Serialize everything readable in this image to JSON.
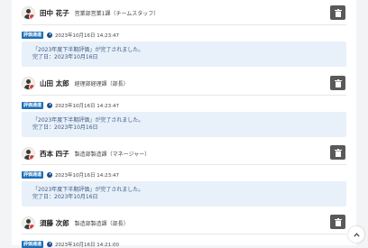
{
  "notifications": [
    {
      "name": "田中 花子",
      "dept": "営業部営業1課（チームスタッフ）",
      "badge": "評価通達",
      "time": "2023年10月16日 14:23:47",
      "message_line1": "「2023年度下半期評価」が完了されました。",
      "message_line2": "完了日：2023年10月16日"
    },
    {
      "name": "山田 太郎",
      "dept": "経理部経理課（部長）",
      "badge": "評価通達",
      "time": "2023年10月16日 14:23:47",
      "message_line1": "「2023年度下半期評価」が完了されました。",
      "message_line2": "完了日：2023年10月16日"
    },
    {
      "name": "西本 四子",
      "dept": "製造部製造課（マネージャー）",
      "badge": "評価通達",
      "time": "2023年10月16日 14:23:47",
      "message_line1": "「2023年度下半期評価」が完了されました。",
      "message_line2": "完了日：2023年10月16日"
    },
    {
      "name": "須藤 次郎",
      "dept": "製造部製造課（部長）",
      "badge": "評価通達",
      "time": "2023年10月16日 14:21:00"
    }
  ],
  "icons": {
    "delete": "trash-icon",
    "time": "clock-icon",
    "scroll": "chevron-up-icon",
    "avatar": "user-avatar-icon"
  },
  "colors": {
    "badge": "#1d6fb8",
    "message_bg": "#e8f0fa",
    "delete_button": "#595959",
    "status_dot": "#e53935"
  }
}
